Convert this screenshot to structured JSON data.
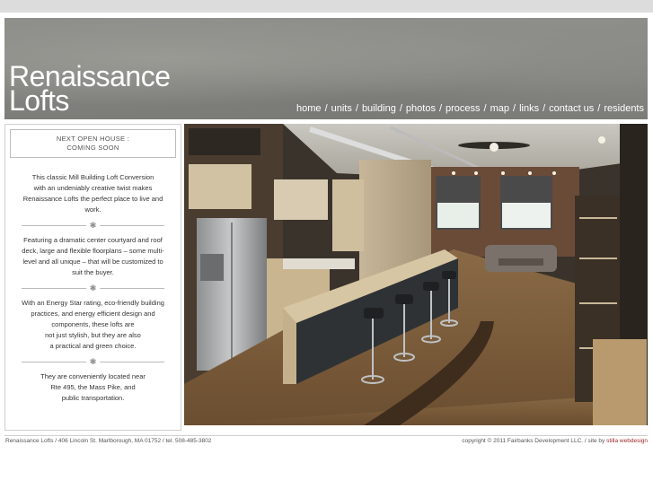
{
  "site": {
    "logo_line1": "Renaissance",
    "logo_line2": "Lofts"
  },
  "nav": {
    "items": [
      "home",
      "units",
      "building",
      "photos",
      "process",
      "map",
      "links",
      "contact us",
      "residents"
    ],
    "separator": "/"
  },
  "sidebar": {
    "open_house_line1": "NEXT OPEN HOUSE :",
    "open_house_line2": "COMING SOON",
    "paragraphs": [
      [
        "This classic Mill Building Loft Conversion",
        "with an undeniably creative twist makes",
        "Renaissance Lofts the perfect place to live and",
        "work."
      ],
      [
        "Featuring a dramatic center courtyard and roof",
        "deck, large and flexible floorplans – some multi-",
        "level and all unique – that will be customized to",
        "suit the buyer."
      ],
      [
        "With an Energy Star rating, eco-friendly building",
        "practices, and energy efficient design and",
        "components, these lofts are",
        "not just stylish, but they are also",
        "a practical and green choice."
      ],
      [
        "They are conveniently located near",
        "Rte 495, the Mass Pike, and",
        "public transportation."
      ]
    ],
    "divider_glyph": "❃"
  },
  "footer": {
    "address": "Renaissance Lofts / 406 Lincoln St. Marlborough, MA 01752 / tel. 508-485-3802",
    "copyright": "copyright © 2011 Fairbanks Development LLC. / site by ",
    "credit": "stilla webdesign"
  },
  "colors": {
    "header_gray": "#8a8a86",
    "credit_red": "#a0282a",
    "border": "#cfcfcf"
  }
}
